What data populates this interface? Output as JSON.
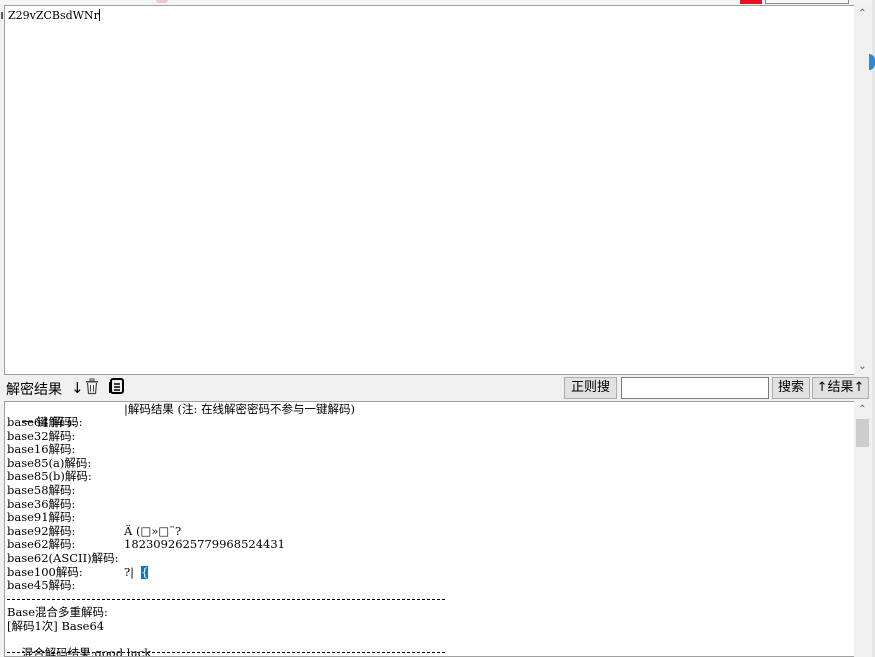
{
  "input": {
    "text": "Z29vZCBsdWNr"
  },
  "toolbar": {
    "label": "解密结果",
    "download_icon": "↓",
    "trash_icon": "trash",
    "copy_icon": "copy",
    "regex_button": "正则搜",
    "search_value": "",
    "search_button": "搜索",
    "result_button": "↑结果↑"
  },
  "output": {
    "header_left": "一 键 解 码:",
    "header_right": "|解码结果 (注: 在线解密密码不参与一键解码)",
    "rows": [
      {
        "label": "base64解码:",
        "value": ""
      },
      {
        "label": "base32解码:",
        "value": ""
      },
      {
        "label": "base16解码:",
        "value": ""
      },
      {
        "label": "base85(a)解码:",
        "value": ""
      },
      {
        "label": "base85(b)解码:",
        "value": ""
      },
      {
        "label": "base58解码:",
        "value": ""
      },
      {
        "label": "base36解码:",
        "value": ""
      },
      {
        "label": "base91解码:",
        "value": ""
      },
      {
        "label": "base92解码:",
        "value": "Ä (□»□¨?"
      },
      {
        "label": "base62解码:",
        "value": "1823092625779968524431"
      },
      {
        "label": "base62(ASCII)解码:",
        "value": ""
      },
      {
        "label": "base100解码:",
        "value": "?|"
      },
      {
        "label": "base45解码:",
        "value": ""
      }
    ],
    "base100_highlight": "{",
    "mixed_title": "Base混合多重解码:",
    "mixed_step": "[解码1次] Base64",
    "mixed_result_label": "混合解码结果:",
    "mixed_result_value": "good luck"
  }
}
